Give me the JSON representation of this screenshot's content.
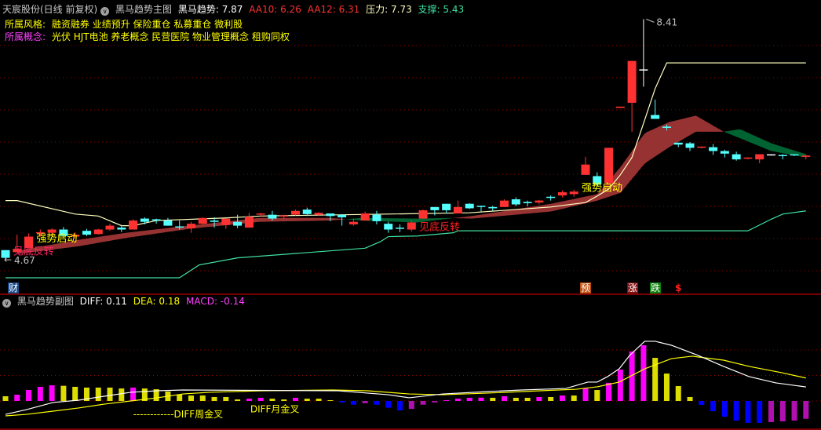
{
  "header": {
    "stock": "天宸股份(日线 前复权)",
    "indicator": "黑马趋势主图",
    "trend_label": "黑马趋势: 7.87",
    "aa10_label": "AA10: 6.26",
    "aa12_label": "AA12: 6.31",
    "pressure_label": "压力: 7.73",
    "support_label": "支撑: 5.43",
    "style_label": "所属风格:",
    "style_value": "融资融券 业绩预升 保险重仓 私募重仓 微利股",
    "concept_label": "所属概念:",
    "concept_value": "光伏 HJT电池 养老概念 民营医院 物业管理概念 租购同权"
  },
  "sub_header": {
    "indicator": "黑马趋势副图",
    "diff_label": "DIFF: 0.11",
    "dea_label": "DEA: 0.18",
    "macd_label": "MACD: -0.14"
  },
  "badges": {
    "cai": "财",
    "yu": "预",
    "zhang": "涨",
    "die": "跌",
    "dollar": "$"
  },
  "colors": {
    "up": "#ff3232",
    "down": "#54ffff",
    "band_up": "#963232",
    "band_down": "#006432",
    "pressure": "#ffffc0",
    "support": "#40e0a0",
    "macd_up": "#ff00ff",
    "macd_up_weak": "#dddd00",
    "macd_down": "#0000ff",
    "macd_down_weak": "#b010b0",
    "diff": "#ffffff",
    "dea": "#ffff00"
  },
  "chart_data": [
    {
      "type": "candlestick",
      "price_gridlines": [
        8.0,
        7.5,
        7.0,
        6.5,
        6.0,
        5.5,
        5.0,
        4.5
      ],
      "high_label": "8.41",
      "low_label": "4.67",
      "candles": [
        [
          4.82,
          4.82,
          4.67,
          4.7
        ],
        [
          4.79,
          5.06,
          4.79,
          4.84
        ],
        [
          4.85,
          5.08,
          4.85,
          5.03
        ],
        [
          5.08,
          5.14,
          5.03,
          5.09
        ],
        [
          5.09,
          5.16,
          5.03,
          5.14
        ],
        [
          5.14,
          5.18,
          5.01,
          5.04
        ],
        [
          5.03,
          5.1,
          5.0,
          5.06
        ],
        [
          5.12,
          5.15,
          5.04,
          5.06
        ],
        [
          5.07,
          5.15,
          5.06,
          5.14
        ],
        [
          5.14,
          5.23,
          5.12,
          5.2
        ],
        [
          5.17,
          5.21,
          5.1,
          5.14
        ],
        [
          5.14,
          5.3,
          5.14,
          5.28
        ],
        [
          5.31,
          5.33,
          5.22,
          5.26
        ],
        [
          5.29,
          5.31,
          5.23,
          5.28
        ],
        [
          5.28,
          5.32,
          5.2,
          5.2
        ],
        [
          5.18,
          5.28,
          5.14,
          5.17
        ],
        [
          5.16,
          5.26,
          5.09,
          5.23
        ],
        [
          5.23,
          5.33,
          5.22,
          5.32
        ],
        [
          5.28,
          5.33,
          5.17,
          5.26
        ],
        [
          5.21,
          5.31,
          5.15,
          5.31
        ],
        [
          5.26,
          5.37,
          5.16,
          5.2
        ],
        [
          5.17,
          5.4,
          5.17,
          5.34
        ],
        [
          5.37,
          5.4,
          5.34,
          5.38
        ],
        [
          5.37,
          5.43,
          5.28,
          5.31
        ],
        [
          5.34,
          5.37,
          5.3,
          5.35
        ],
        [
          5.37,
          5.45,
          5.36,
          5.43
        ],
        [
          5.45,
          5.48,
          5.35,
          5.38
        ],
        [
          5.37,
          5.41,
          5.35,
          5.4
        ],
        [
          5.39,
          5.39,
          5.27,
          5.35
        ],
        [
          5.37,
          5.37,
          5.2,
          5.33
        ],
        [
          5.22,
          5.31,
          5.2,
          5.26
        ],
        [
          5.28,
          5.42,
          5.28,
          5.39
        ],
        [
          5.37,
          5.43,
          5.22,
          5.27
        ],
        [
          5.23,
          5.26,
          5.09,
          5.14
        ],
        [
          5.16,
          5.22,
          5.1,
          5.15
        ],
        [
          5.14,
          5.28,
          5.11,
          5.25
        ],
        [
          5.31,
          5.45,
          5.31,
          5.44
        ],
        [
          5.49,
          5.49,
          5.36,
          5.44
        ],
        [
          5.54,
          5.54,
          5.39,
          5.44
        ],
        [
          5.39,
          5.59,
          5.39,
          5.49
        ],
        [
          5.54,
          5.55,
          5.46,
          5.47
        ],
        [
          5.5,
          5.51,
          5.42,
          5.49
        ],
        [
          5.49,
          5.51,
          5.43,
          5.47
        ],
        [
          5.49,
          5.61,
          5.49,
          5.59
        ],
        [
          5.61,
          5.64,
          5.5,
          5.53
        ],
        [
          5.57,
          5.59,
          5.5,
          5.55
        ],
        [
          5.56,
          5.6,
          5.53,
          5.59
        ],
        [
          5.64,
          5.67,
          5.59,
          5.63
        ],
        [
          5.67,
          5.75,
          5.64,
          5.72
        ],
        [
          5.69,
          5.76,
          5.65,
          5.73
        ],
        [
          5.99,
          6.27,
          5.99,
          6.15
        ],
        [
          5.97,
          6.03,
          5.81,
          5.84
        ],
        [
          5.86,
          6.41,
          5.86,
          6.41
        ],
        [
          7.03,
          7.05,
          7.03,
          7.05
        ],
        [
          7.11,
          7.76,
          6.66,
          7.76
        ],
        [
          7.62,
          8.41,
          7.36,
          7.62
        ],
        [
          6.92,
          7.16,
          6.86,
          6.86
        ],
        [
          6.74,
          6.77,
          6.68,
          6.72
        ],
        [
          6.49,
          6.49,
          6.42,
          6.46
        ],
        [
          6.48,
          6.5,
          6.36,
          6.41
        ],
        [
          6.41,
          6.43,
          6.4,
          6.42
        ],
        [
          6.42,
          6.47,
          6.3,
          6.36
        ],
        [
          6.36,
          6.38,
          6.26,
          6.32
        ],
        [
          6.31,
          6.35,
          6.21,
          6.23
        ],
        [
          6.24,
          6.26,
          6.23,
          6.25
        ],
        [
          6.23,
          6.31,
          6.17,
          6.31
        ],
        [
          6.3,
          6.31,
          6.29,
          6.3
        ],
        [
          6.29,
          6.31,
          6.23,
          6.28
        ],
        [
          6.3,
          6.31,
          6.28,
          6.29
        ],
        [
          6.27,
          6.29,
          6.23,
          6.29
        ]
      ],
      "pressure_line": [
        [
          0,
          5.59
        ],
        [
          1,
          5.59
        ],
        [
          6,
          5.38
        ],
        [
          8,
          5.35
        ],
        [
          10,
          5.2
        ],
        [
          11,
          5.2
        ],
        [
          13,
          5.28
        ],
        [
          19,
          5.32
        ],
        [
          22,
          5.35
        ],
        [
          40,
          5.4
        ],
        [
          47,
          5.49
        ],
        [
          50,
          5.56
        ],
        [
          51,
          5.66
        ],
        [
          52,
          5.77
        ],
        [
          53,
          5.99
        ],
        [
          54,
          6.26
        ],
        [
          55,
          6.79
        ],
        [
          56,
          7.33
        ],
        [
          57,
          7.73
        ],
        [
          69,
          7.73
        ]
      ],
      "support_line": [
        [
          0,
          4.39
        ],
        [
          15,
          4.39
        ],
        [
          16.7,
          4.59
        ],
        [
          20,
          4.7
        ],
        [
          31,
          4.85
        ],
        [
          32.3,
          4.95
        ],
        [
          33,
          5.03
        ],
        [
          35.5,
          5.04
        ],
        [
          38.6,
          5.09
        ],
        [
          39,
          5.12
        ],
        [
          64,
          5.12
        ],
        [
          66,
          5.3
        ],
        [
          67,
          5.38
        ],
        [
          69,
          5.43
        ]
      ],
      "aa10": [
        [
          1,
          4.81
        ],
        [
          6.3,
          4.98
        ],
        [
          10.4,
          5.09
        ],
        [
          15.8,
          5.2
        ],
        [
          21.9,
          5.32
        ],
        [
          28,
          5.32
        ],
        [
          30.7,
          5.28
        ],
        [
          35.5,
          5.25
        ],
        [
          38.2,
          5.31
        ],
        [
          40.2,
          5.35
        ],
        [
          47,
          5.54
        ],
        [
          51,
          5.69
        ],
        [
          53,
          6.11
        ],
        [
          55.1,
          6.64
        ],
        [
          57.2,
          6.81
        ],
        [
          59.5,
          6.91
        ],
        [
          61.9,
          6.66
        ],
        [
          63.3,
          6.56
        ],
        [
          66,
          6.36
        ],
        [
          69,
          6.26
        ]
      ],
      "aa12": [
        [
          1,
          4.76
        ],
        [
          6.3,
          4.88
        ],
        [
          10.4,
          5.01
        ],
        [
          15.8,
          5.15
        ],
        [
          21.9,
          5.26
        ],
        [
          28,
          5.28
        ],
        [
          30.7,
          5.32
        ],
        [
          35.5,
          5.31
        ],
        [
          38.2,
          5.32
        ],
        [
          40.2,
          5.31
        ],
        [
          47,
          5.42
        ],
        [
          51,
          5.59
        ],
        [
          53,
          5.71
        ],
        [
          55.1,
          6.17
        ],
        [
          57.2,
          6.42
        ],
        [
          59.5,
          6.66
        ],
        [
          61.9,
          6.66
        ],
        [
          63.3,
          6.7
        ],
        [
          66,
          6.48
        ],
        [
          69,
          6.31
        ]
      ],
      "annotations": [
        {
          "text": "强势启动",
          "index": 3,
          "price": 4.95,
          "color": "#ffff00"
        },
        {
          "text": "见底反转",
          "index": 1,
          "price": 4.75,
          "color": "#ff2060"
        },
        {
          "text": "见底反转",
          "index": 36,
          "price": 5.13,
          "color": "#ff2020"
        },
        {
          "text": "强势启动",
          "index": 50,
          "price": 5.74,
          "color": "#ffff00"
        }
      ]
    },
    {
      "type": "macd",
      "gridlines": [
        0,
        0.2,
        0.4
      ],
      "macd": [
        0.037,
        0.049,
        0.086,
        0.111,
        0.123,
        0.119,
        0.111,
        0.105,
        0.105,
        0.105,
        0.098,
        0.105,
        0.098,
        0.092,
        0.074,
        0.051,
        0.043,
        0.043,
        0.031,
        0.031,
        0.012,
        0.018,
        0.025,
        0.018,
        0.012,
        0.025,
        0.018,
        0.018,
        0.006,
        -0.012,
        -0.029,
        -0.018,
        -0.029,
        -0.053,
        -0.074,
        -0.062,
        -0.029,
        -0.012,
        0.006,
        0.018,
        0.025,
        0.026,
        0.025,
        0.037,
        0.025,
        0.025,
        0.031,
        0.031,
        0.043,
        0.043,
        0.098,
        0.086,
        0.142,
        0.246,
        0.388,
        0.437,
        0.338,
        0.215,
        0.117,
        0.031,
        -0.031,
        -0.08,
        -0.123,
        -0.154,
        -0.172,
        -0.172,
        -0.166,
        -0.16,
        -0.154,
        -0.14
      ],
      "diff": [
        [
          0,
          -0.105
        ],
        [
          1.8,
          -0.068
        ],
        [
          4.1,
          -0.012
        ],
        [
          6.3,
          0.006
        ],
        [
          8.5,
          0.037
        ],
        [
          10.8,
          0.068
        ],
        [
          13.1,
          0.08
        ],
        [
          15.3,
          0.086
        ],
        [
          28.7,
          0.08
        ],
        [
          33,
          0.049
        ],
        [
          34.8,
          0.025
        ],
        [
          37.7,
          0.055
        ],
        [
          41.6,
          0.074
        ],
        [
          44.5,
          0.086
        ],
        [
          48.3,
          0.098
        ],
        [
          50.2,
          0.148
        ],
        [
          51,
          0.148
        ],
        [
          51.9,
          0.191
        ],
        [
          52.9,
          0.252
        ],
        [
          53.8,
          0.357
        ],
        [
          55.1,
          0.468
        ],
        [
          56,
          0.468
        ],
        [
          57.4,
          0.437
        ],
        [
          59.7,
          0.357
        ],
        [
          61.9,
          0.271
        ],
        [
          64.1,
          0.191
        ],
        [
          66.4,
          0.142
        ],
        [
          69,
          0.11
        ]
      ],
      "dea": [
        [
          0,
          -0.117
        ],
        [
          1.8,
          -0.105
        ],
        [
          4.1,
          -0.08
        ],
        [
          6.3,
          -0.055
        ],
        [
          8.5,
          -0.025
        ],
        [
          10.8,
          0.0
        ],
        [
          13.1,
          0.025
        ],
        [
          15.3,
          0.055
        ],
        [
          17.6,
          0.068
        ],
        [
          22.1,
          0.08
        ],
        [
          28.2,
          0.086
        ],
        [
          31.2,
          0.08
        ],
        [
          34.8,
          0.055
        ],
        [
          37.7,
          0.049
        ],
        [
          41.6,
          0.062
        ],
        [
          46.1,
          0.08
        ],
        [
          49.2,
          0.092
        ],
        [
          51,
          0.111
        ],
        [
          52.9,
          0.148
        ],
        [
          55.1,
          0.252
        ],
        [
          57.4,
          0.332
        ],
        [
          59.2,
          0.351
        ],
        [
          61.9,
          0.32
        ],
        [
          64.1,
          0.271
        ],
        [
          66.9,
          0.222
        ],
        [
          69,
          0.18
        ]
      ],
      "annotations": [
        {
          "text": "------------DIFF周金叉",
          "index": 11,
          "value": -0.13,
          "color": "#ffff00"
        },
        {
          "text": "DIFF月金叉",
          "index": 21.1,
          "value": -0.09,
          "color": "#ffff00"
        }
      ]
    }
  ]
}
